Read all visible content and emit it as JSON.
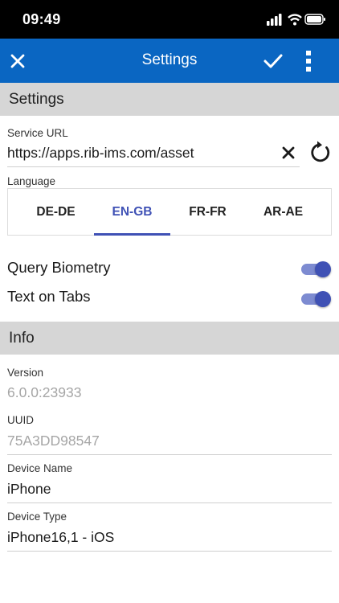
{
  "status_bar": {
    "time": "09:49"
  },
  "app_bar": {
    "title": "Settings",
    "close_icon": "close-icon",
    "confirm_icon": "check-icon",
    "menu_icon": "more-vertical-icon"
  },
  "settings_section": {
    "title": "Settings"
  },
  "service_url": {
    "label": "Service URL",
    "value": "https://apps.rib-ims.com/asset"
  },
  "language": {
    "label": "Language",
    "options": [
      "DE-DE",
      "EN-GB",
      "FR-FR",
      "AR-AE"
    ],
    "selected": "EN-GB"
  },
  "toggles": [
    {
      "label": "Query Biometry",
      "on": true
    },
    {
      "label": "Text on Tabs",
      "on": true
    }
  ],
  "info_section": {
    "title": "Info"
  },
  "info": {
    "version": {
      "label": "Version",
      "value": "6.0.0:23933"
    },
    "uuid": {
      "label": "UUID",
      "value": "75A3DD98547"
    },
    "device_name": {
      "label": "Device Name",
      "value": "iPhone"
    },
    "device_type": {
      "label": "Device Type",
      "value": "iPhone16,1 - iOS"
    }
  },
  "colors": {
    "app_bar": "#0a66c2",
    "accent": "#3f51b5",
    "section_bg": "#d6d6d6"
  }
}
